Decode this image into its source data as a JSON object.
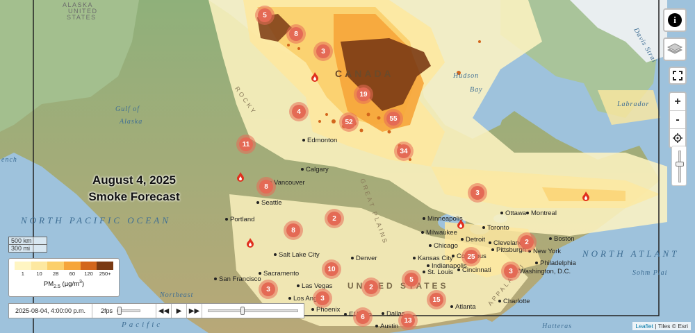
{
  "map": {
    "title_line1": "August 4, 2025",
    "title_line2": "Smoke Forecast",
    "labels": {
      "alaska": "ALASKA",
      "united": "UNITED",
      "states_top": "STATES",
      "canada": "CANADA",
      "north_pacific": "NORTH PACIFIC OCEAN",
      "north_atlantic": "NORTH ATLANT",
      "gulf_of": "Gulf of",
      "alaska_gulf": "Alaska",
      "french": "ench",
      "hudson": "Hudson",
      "bay": "Bay",
      "labrador": "Labrador",
      "davis_strait": "Davis Strai",
      "rocky": "ROCKY",
      "great_plains": "GREAT PLAINS",
      "appalachian": "APPALACHI",
      "united_states": "UNITED STATES",
      "sohm_plain": "Sohm Plai",
      "northeast": "Northeast",
      "pacific_bottom": "Pacific",
      "hatteras": "Hatteras"
    },
    "cities": [
      "Edmonton",
      "Calgary",
      "Vancouver",
      "Seattle",
      "Portland",
      "Salt Lake City",
      "Sacramento",
      "San Francisco",
      "Las Vegas",
      "Los Angeles",
      "Phoenix",
      "El Paso",
      "Dallas",
      "Austin",
      "Denver",
      "Kansas City",
      "St. Louis",
      "Minneapolis",
      "Milwaukee",
      "Chicago",
      "Indianapolis",
      "Columbus",
      "Cincinnati",
      "Detroit",
      "Toronto",
      "Cleveland",
      "Pittsburgh",
      "Ottawa",
      "Montreal",
      "New York",
      "Boston",
      "Philadelphia",
      "Washington, D.C.",
      "Atlanta",
      "Charlotte"
    ],
    "clusters": [
      "5",
      "8",
      "3",
      "19",
      "4",
      "52",
      "55",
      "34",
      "11",
      "8",
      "3",
      "2",
      "8",
      "10",
      "3",
      "3",
      "2",
      "5",
      "25",
      "2",
      "3",
      "15",
      "6",
      "13"
    ]
  },
  "controls": {
    "info_icon": "i",
    "layers_icon": "layers-icon",
    "fullscreen_icon": "fullscreen-icon",
    "zoom_in": "+",
    "zoom_out": "-",
    "locate_icon": "locate-icon"
  },
  "scale": {
    "km": "500 km",
    "mi": "300 mi"
  },
  "legend": {
    "ticks": [
      "1",
      "10",
      "28",
      "60",
      "120",
      "250+"
    ],
    "colors": [
      "#fff5c2",
      "#fde8a0",
      "#fbcf6b",
      "#f6a53a",
      "#d3661c",
      "#7a3a14"
    ],
    "unit": "PM2.5 (µg/m³)"
  },
  "player": {
    "time": "2025-08-04, 4:00:00 p.m.",
    "fps": "2fps",
    "fps_level": 0.1,
    "progress": 0.38
  },
  "attribution": {
    "leaflet": "Leaflet",
    "tiles": "Tiles © Esri"
  }
}
